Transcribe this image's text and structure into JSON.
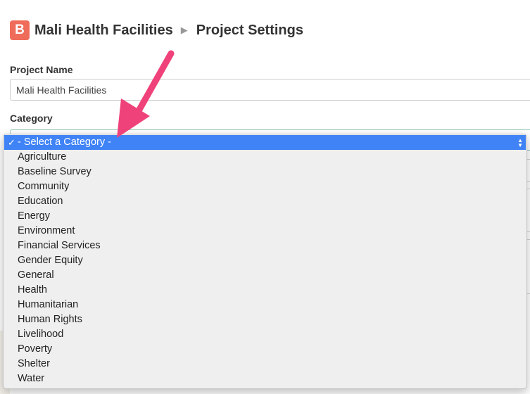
{
  "header": {
    "logo_letter": "B",
    "project": "Mali Health Facilities",
    "separator": "▶",
    "page": "Project Settings"
  },
  "form": {
    "project_name_label": "Project Name",
    "project_name_value": "Mali Health Facilities",
    "category_label": "Category"
  },
  "dropdown": {
    "selected_label": "- Select a Category -",
    "check": "✓",
    "options": [
      "Agriculture",
      "Baseline Survey",
      "Community",
      "Education",
      "Energy",
      "Environment",
      "Financial Services",
      "Gender Equity",
      "General",
      "Health",
      "Humanitarian",
      "Human Rights",
      "Livelihood",
      "Poverty",
      "Shelter",
      "Water"
    ]
  },
  "annotation": {
    "arrow_color": "#f0427a"
  }
}
